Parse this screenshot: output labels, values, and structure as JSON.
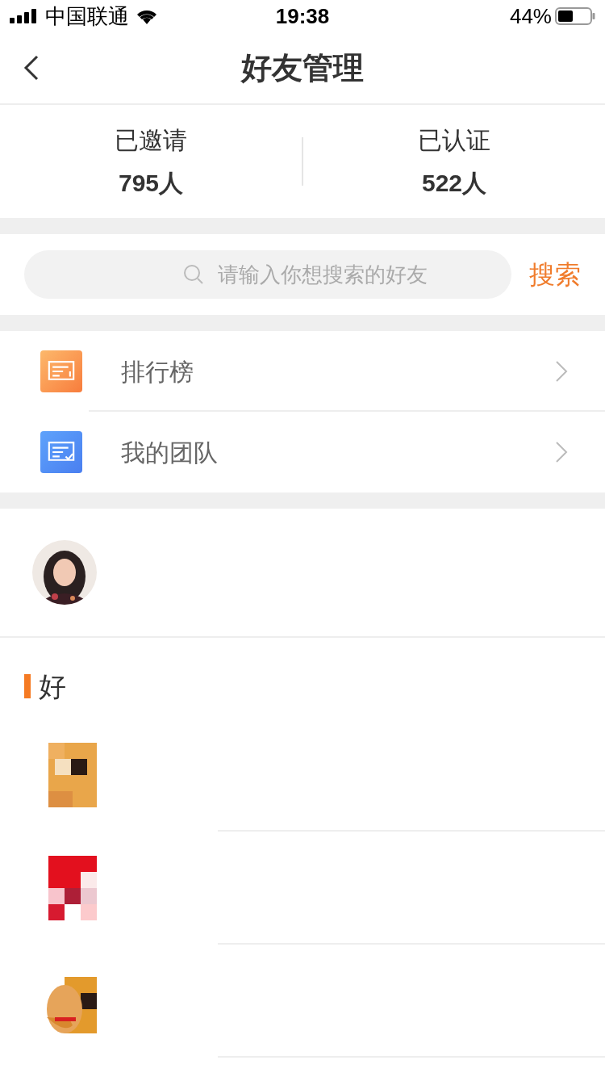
{
  "status_bar": {
    "carrier": "中国联通",
    "time": "19:38",
    "battery": "44%"
  },
  "nav": {
    "title": "好友管理"
  },
  "stats": [
    {
      "label": "已邀请",
      "value": "795人"
    },
    {
      "label": "已认证",
      "value": "522人"
    }
  ],
  "search": {
    "placeholder": "请输入你想搜索的好友",
    "button": "搜索"
  },
  "menu": [
    {
      "kind": "ranking",
      "label": "排行榜"
    },
    {
      "kind": "team",
      "label": "我的团队"
    }
  ],
  "friends_section": {
    "title": "好"
  }
}
